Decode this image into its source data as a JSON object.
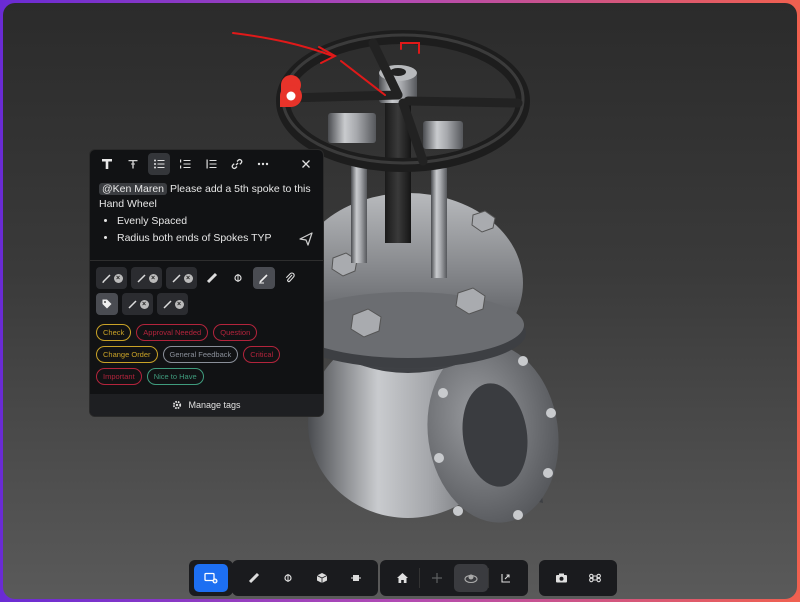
{
  "comment": {
    "mention": "@Ken Maren",
    "text": "Please add a 5th spoke to this Hand Wheel",
    "bullets": [
      "Evenly Spaced",
      "Radius both ends of Spokes TYP"
    ]
  },
  "format_toolbar": {
    "icons": [
      "bold-t-icon",
      "text-size-icon",
      "bullet-list-icon",
      "numbered-list-icon",
      "quote-icon",
      "link-icon",
      "more-icon",
      "close-icon"
    ]
  },
  "tags": [
    {
      "label": "Check",
      "color": "#c9a227"
    },
    {
      "label": "Approval Needed",
      "color": "#b3243c"
    },
    {
      "label": "Question",
      "color": "#b3243c"
    },
    {
      "label": "Change Order",
      "color": "#c9a227"
    },
    {
      "label": "General Feedback",
      "color": "#8a8f99"
    },
    {
      "label": "Critical",
      "color": "#b3243c"
    },
    {
      "label": "Important",
      "color": "#b3243c"
    },
    {
      "label": "Nice to Have",
      "color": "#3f9b7d"
    }
  ],
  "manage_tags_label": "Manage tags",
  "colors": {
    "accent": "#1d6ff2",
    "marker": "#e8332a",
    "sketch": "#e01919"
  }
}
